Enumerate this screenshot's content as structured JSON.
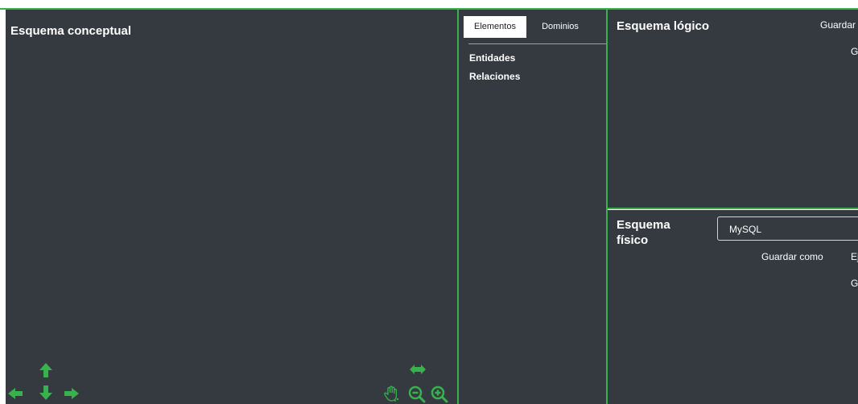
{
  "conceptual": {
    "title": "Esquema conceptual",
    "controls": [
      "arrow-up-icon",
      "arrow-left-icon",
      "arrow-down-icon",
      "arrow-right-icon",
      "arrows-horizontal-icon",
      "hand-pan-icon",
      "zoom-out-icon",
      "zoom-in-icon"
    ]
  },
  "elements_panel": {
    "tabs": [
      {
        "label": "Elementos",
        "active": true
      },
      {
        "label": "Dominios",
        "active": false
      }
    ],
    "tree": [
      {
        "label": "Entidades"
      },
      {
        "label": "Relaciones"
      }
    ]
  },
  "logico": {
    "title": "Esquema lógico",
    "save_label": "Guardar",
    "g_label": "G"
  },
  "fisico": {
    "title": "Esquema físico",
    "engine_selected": "MySQL",
    "save_as_label": "Guardar como",
    "ej_label": "Ej",
    "g_label": "G"
  },
  "colors": {
    "accent": "#37b24d",
    "panel": "#343a40",
    "background": "#ffffff"
  }
}
